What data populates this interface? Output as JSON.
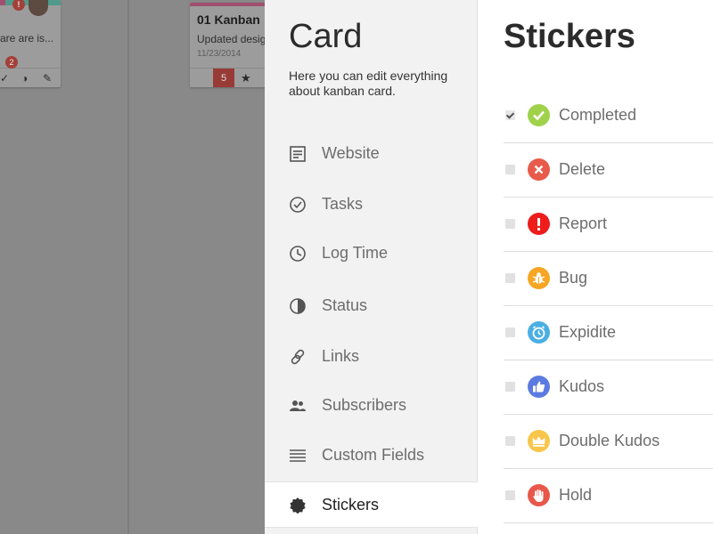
{
  "board": {
    "card_one": {
      "alert": "!",
      "excerpt": "are are is...",
      "comment_count": "2"
    },
    "card_two": {
      "title": "01 Kanban",
      "excerpt": "Updated desig",
      "date": "11/23/2014",
      "count": "5"
    }
  },
  "card_panel": {
    "title": "Card",
    "subtitle": "Here you can edit everything about kanban card.",
    "menu": [
      {
        "label": "Website",
        "icon": "document-icon"
      },
      {
        "label": "Tasks",
        "icon": "check-circle-icon"
      },
      {
        "label": "Log Time",
        "icon": "clock-icon"
      },
      {
        "label": "Status",
        "icon": "pie-icon"
      },
      {
        "label": "Links",
        "icon": "link-icon"
      },
      {
        "label": "Subscribers",
        "icon": "people-icon"
      },
      {
        "label": "Custom Fields",
        "icon": "lines-icon"
      },
      {
        "label": "Stickers",
        "icon": "badge-icon",
        "active": true
      }
    ]
  },
  "stickers_panel": {
    "title": "Stickers",
    "items": [
      {
        "label": "Completed",
        "checked": true,
        "color": "#9fd24a",
        "icon": "check-icon"
      },
      {
        "label": "Delete",
        "checked": false,
        "color": "#e85a4a",
        "icon": "close-icon"
      },
      {
        "label": "Report",
        "checked": false,
        "color": "#ef1c1c",
        "icon": "exclamation-icon"
      },
      {
        "label": "Bug",
        "checked": false,
        "color": "#f6a623",
        "icon": "bug-icon"
      },
      {
        "label": "Expidite",
        "checked": false,
        "color": "#4aaee3",
        "icon": "alarm-icon"
      },
      {
        "label": "Kudos",
        "checked": false,
        "color": "#5b7be0",
        "icon": "thumbs-up-icon"
      },
      {
        "label": "Double Kudos",
        "checked": false,
        "color": "#f7c64a",
        "icon": "crown-icon"
      },
      {
        "label": "Hold",
        "checked": false,
        "color": "#e8574a",
        "icon": "hand-icon"
      }
    ]
  }
}
